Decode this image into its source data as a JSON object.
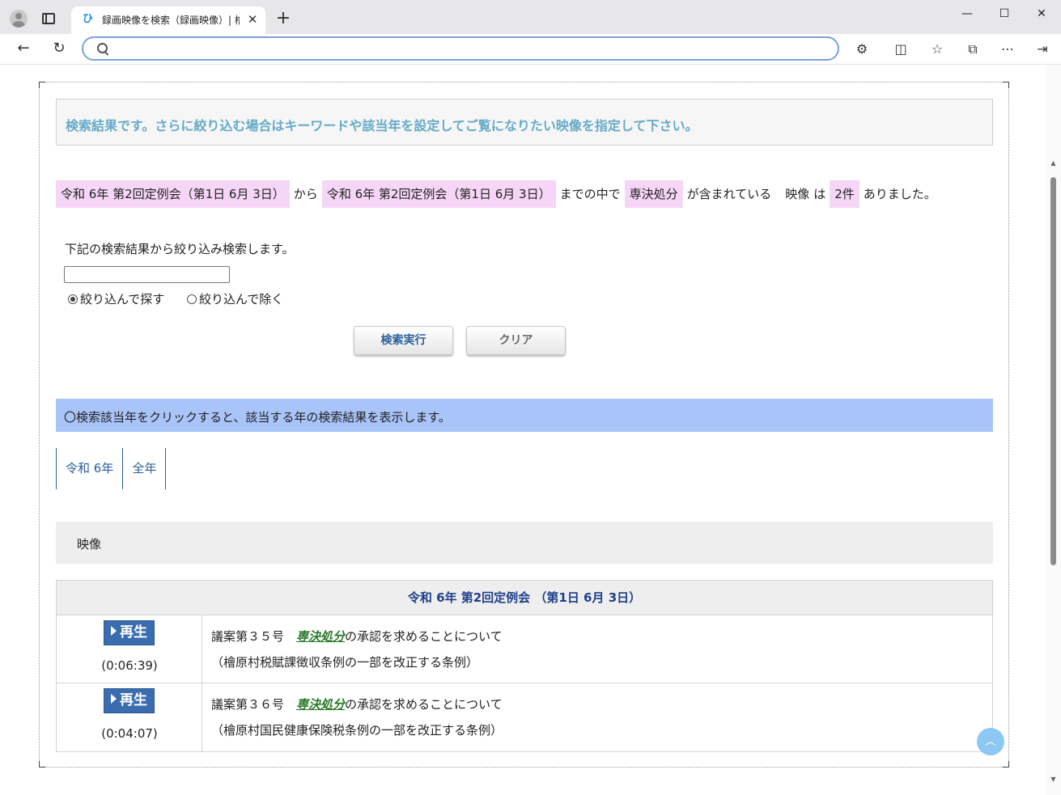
{
  "browser": {
    "tab_title": "録画映像を検索（録画映像）| 檜",
    "tab_close": "✕",
    "new_tab": "+",
    "address_value": "",
    "controls": {
      "minimize": "—",
      "maximize": "☐",
      "close": "✕"
    }
  },
  "page": {
    "notice": "検索結果です。さらに絞り込む場合はキーワードや該当年を設定してご覧になりたい映像を指定して下さい。",
    "condition": {
      "from": "令和 6年 第2回定例会（第1日 6月 3日）",
      "from_suffix": "から",
      "to": "令和 6年 第2回定例会（第1日 6月 3日）",
      "to_suffix": "までの中で",
      "keyword": "専決処分",
      "keyword_suffix": "が含まれている",
      "video_label": "映像",
      "video_suffix": "は",
      "count": "2件",
      "count_suffix": "ありました。"
    },
    "refine": {
      "label": "下記の検索結果から絞り込み検索します。",
      "input_value": "",
      "option_include": "絞り込んで探す",
      "option_exclude": "絞り込んで除く",
      "selected": "include"
    },
    "buttons": {
      "search": "検索実行",
      "clear": "クリア"
    },
    "year_note": "〇検索該当年をクリックすると、該当する年の検索結果を表示します。",
    "year_tabs": [
      "令和 6年",
      "全年"
    ],
    "section_title": "映像",
    "results": {
      "session": "令和 6年 第2回定例会 （第1日 6月 3日）",
      "play_label": "再生",
      "rows": [
        {
          "duration": "(0:06:39)",
          "title_prefix": "議案第３５号　",
          "keyword": "専決処分",
          "title_suffix": "の承認を求めることについて",
          "subtitle": "（檜原村税賦課徴収条例の一部を改正する条例）"
        },
        {
          "duration": "(0:04:07)",
          "title_prefix": "議案第３６号　",
          "keyword": "専決処分",
          "title_suffix": "の承認を求めることについて",
          "subtitle": "（檜原村国民健康保険税条例の一部を改正する条例）"
        }
      ]
    }
  },
  "colors": {
    "notice_text": "#66aac8",
    "highlight": "#f6d6f6",
    "year_note_bg": "#a9c4f9",
    "link": "#2a5f9a",
    "play_button": "#3a6db0",
    "keyword": "#2a7a2a"
  }
}
